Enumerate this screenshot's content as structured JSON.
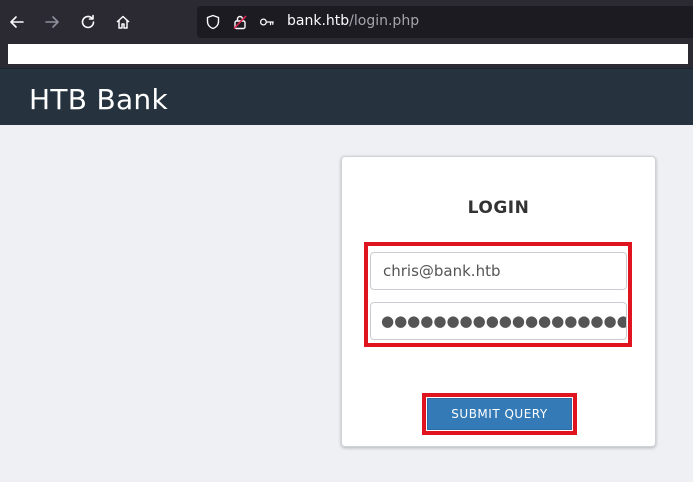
{
  "browser": {
    "url_host": "bank.htb",
    "url_path": "/login.php",
    "icons": {
      "back": "back-arrow-icon",
      "forward": "forward-arrow-icon",
      "reload": "reload-icon",
      "home": "home-icon",
      "shield": "shield-icon",
      "lock": "insecure-lock-icon",
      "key": "key-icon"
    }
  },
  "app": {
    "brand": "HTB Bank"
  },
  "login": {
    "title": "LOGIN",
    "email_value": "chris@bank.htb",
    "password_mask": "●●●●●●●●●●●●●●●●●●●●",
    "submit_label": "SUBMIT QUERY"
  },
  "colors": {
    "header_bg": "#26333e",
    "page_bg": "#eef0f4",
    "button_primary": "#337ab7",
    "highlight": "#e0141e"
  }
}
